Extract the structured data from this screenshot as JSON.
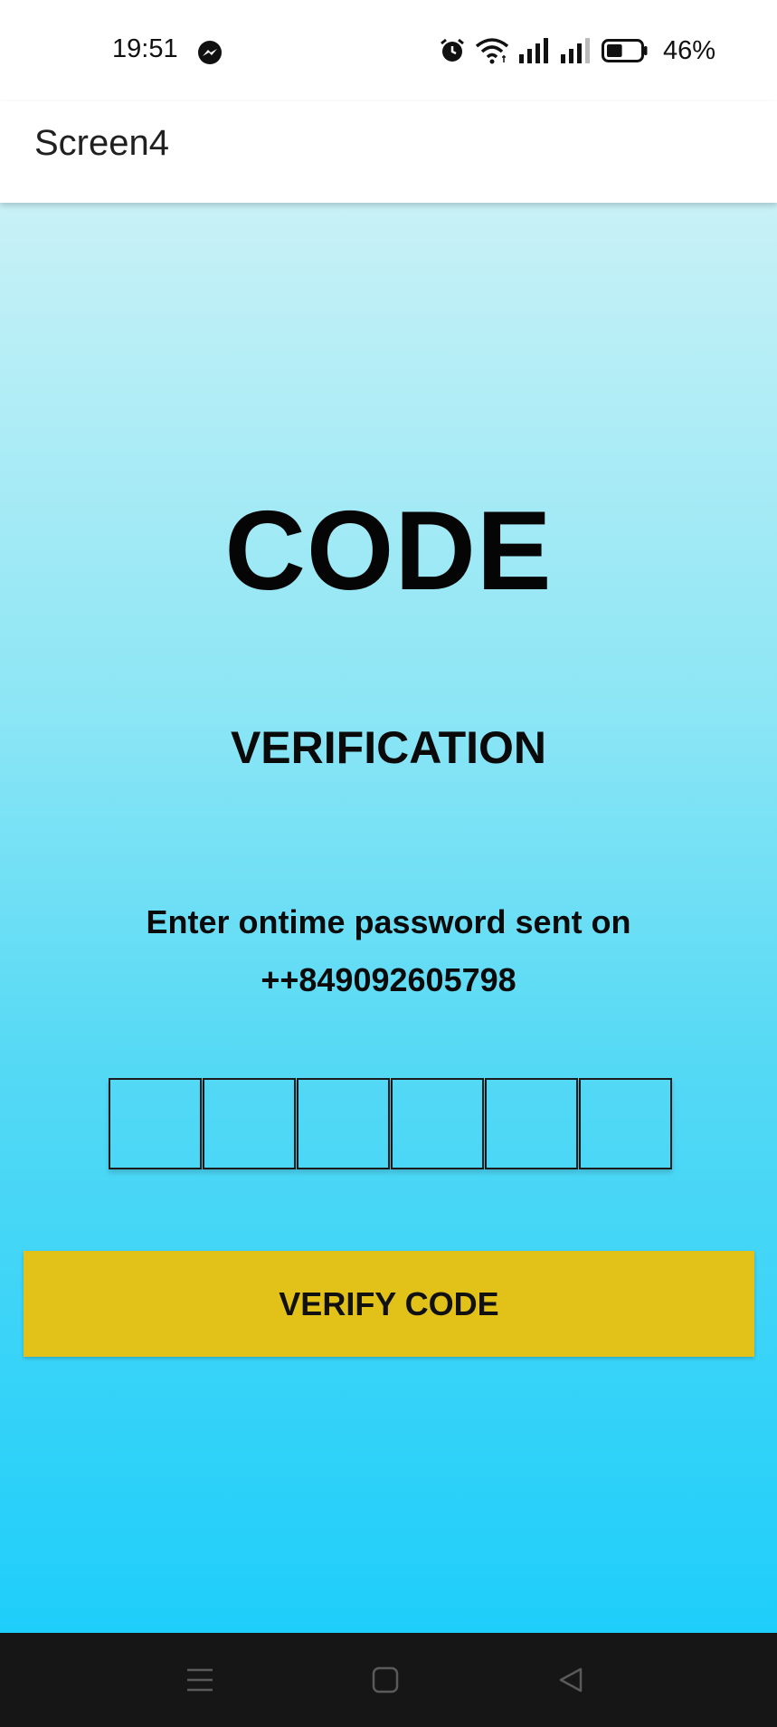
{
  "status_bar": {
    "time": "19:51",
    "battery_percent": "46%",
    "battery_level": 46,
    "icons": [
      "messenger-icon",
      "alarm-icon",
      "wifi-icon",
      "signal-icon",
      "signal-icon",
      "battery-icon"
    ]
  },
  "app_bar": {
    "title": "Screen4"
  },
  "main": {
    "headline": "CODE",
    "subhead": "VERIFICATION",
    "instruction": "Enter ontime password sent on",
    "phone_number": "++849092605798",
    "otp_values": [
      "",
      "",
      "",
      "",
      "",
      ""
    ],
    "verify_button_label": "VERIFY CODE"
  },
  "nav_bar": {
    "icons": [
      "menu-icon",
      "home-icon",
      "back-icon"
    ]
  },
  "colors": {
    "gradient_top": "#c8f1f6",
    "gradient_bottom": "#1ecefa",
    "button": "#e2c218",
    "nav_bar": "#161616"
  }
}
